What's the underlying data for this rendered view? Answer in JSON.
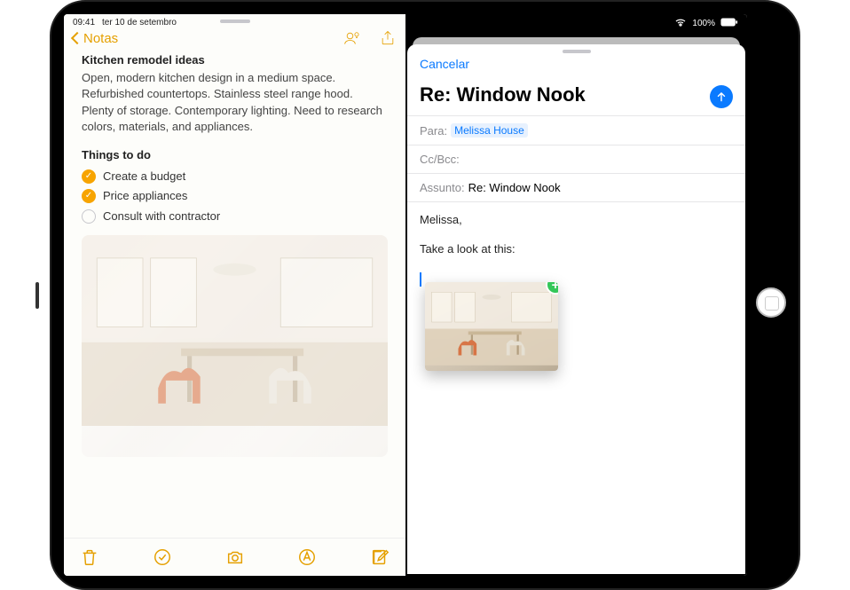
{
  "status": {
    "time": "09:41",
    "date": "ter 10 de setembro",
    "battery": "100%",
    "wifi_icon": "wifi",
    "battery_icon": "battery-full"
  },
  "notes": {
    "back_label": "Notas",
    "collaborate_icon": "collaborate-icon",
    "share_icon": "share-icon",
    "title": "Kitchen remodel ideas",
    "paragraph": "Open, modern kitchen design in a medium space. Refurbished countertops. Stainless steel range hood. Plenty of storage. Contemporary lighting. Need to research colors, materials, and appliances.",
    "subhead": "Things to do",
    "todos": [
      {
        "text": "Create a budget",
        "done": true
      },
      {
        "text": "Price appliances",
        "done": true
      },
      {
        "text": "Consult with contractor",
        "done": false
      }
    ],
    "attachment": "room-photo",
    "toolbar": {
      "trash": "trash-icon",
      "checklist": "checklist-icon",
      "camera": "camera-icon",
      "markup": "markup-icon",
      "compose": "compose-icon"
    }
  },
  "mail": {
    "cancel": "Cancelar",
    "subject_header": "Re: Window Nook",
    "to_label": "Para:",
    "to_value": "Melissa House",
    "ccbcc_label": "Cc/Bcc:",
    "subject_label": "Assunto:",
    "subject_value": "Re:  Window Nook",
    "body_line1": "Melissa,",
    "body_line2": "Take a look at this:",
    "send_icon": "send-up-icon",
    "drag_badge": "+",
    "drag_thumb": "room-photo-thumb"
  }
}
